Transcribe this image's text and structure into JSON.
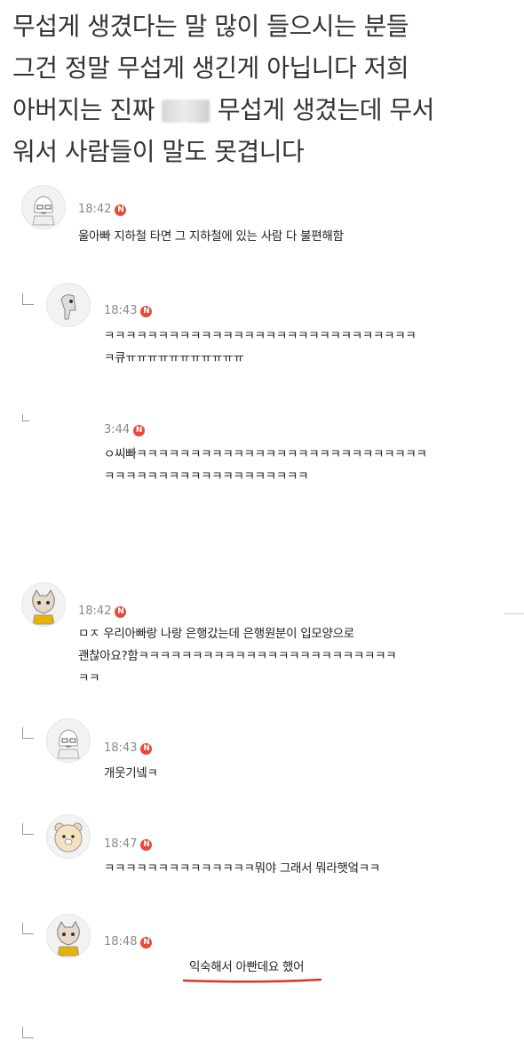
{
  "post": {
    "line1": "무섭게 생겼다는 말 많이 들으시는 분들",
    "line2": "그건 정말 무섭게 생긴게 아닙니다 저희",
    "line3_pre": "아버지는 진짜 ",
    "line3_post": " 무섭게 생겼는데 무서",
    "line4": "워서 사람들이 말도 못겹니다"
  },
  "comments": [
    {
      "time": "18:42",
      "text": "울아빠 지하철 타면 그 지하철에 있는 사람 다 불편해함",
      "avatar": "face-avatar-icon"
    },
    {
      "time": "18:43",
      "text": "ㅋㅋㅋㅋㅋㅋㅋㅋㅋㅋㅋㅋㅋㅋㅋㅋㅋㅋㅋㅋㅋㅋㅋㅋㅋㅋㅋㅋㅋ\nㅋ큐ㅠㅠㅠㅠㅠㅠㅠㅠㅠㅠㅠ",
      "avatar": "character-avatar-icon"
    },
    {
      "time": "3:44",
      "text": "ㅇ씨빠ㅋㅋㅋㅋㅋㅋㅋㅋㅋㅋㅋㅋㅋㅋㅋㅋㅋㅋㅋㅋㅋㅋㅋㅋㅋㅋㅋ\nㅋㅋㅋㅋㅋㅋㅋㅋㅋㅋㅋㅋㅋㅋㅋㅋㅋㅋㅋ",
      "avatar": ""
    },
    {
      "time": "18:42",
      "text": "ㅁㅈ 우리아빠랑 나랑 은행갔는데 은행원분이 입모양으로\n괜찮아요?함ㅋㅋㅋㅋㅋㅋㅋㅋㅋㅋㅋㅋㅋㅋㅋㅋㅋㅋㅋㅋㅋㅋㅋㅋ\nㅋㅋ",
      "avatar": "cat-avatar-icon"
    },
    {
      "time": "18:43",
      "text": "개웃기넼ㅋ",
      "avatar": "face-avatar-icon"
    },
    {
      "time": "18:47",
      "text": "ㅋㅋㅋㅋㅋㅋㅋㅋㅋㅋㅋㅋㅋㅋ뭐야 그래서 뭐라햇엌ㅋㅋ",
      "avatar": "bear-avatar-icon"
    },
    {
      "time": "18:48",
      "text": "익숙해서 아빤데요 했어",
      "avatar": "cat-avatar-icon"
    }
  ],
  "badge_label": "N",
  "colors": {
    "badge": "#e64a3c",
    "underline": "#d9342b"
  }
}
